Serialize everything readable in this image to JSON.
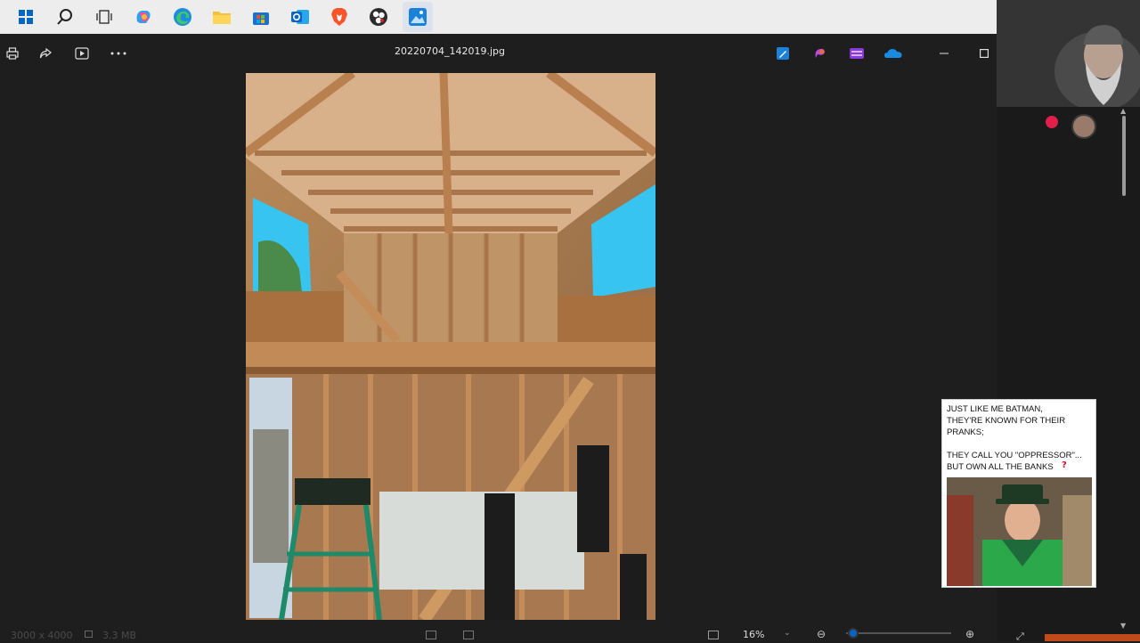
{
  "taskbar": {
    "icons": [
      "windows-start-icon",
      "search-icon",
      "task-view-icon",
      "copilot-icon",
      "edge-icon",
      "file-explorer-icon",
      "store-icon",
      "outlook-icon",
      "brave-icon",
      "obs-icon",
      "photos-icon"
    ]
  },
  "viewer": {
    "filename": "20220704_142019.jpg",
    "status": {
      "dimensions": "3000 x 4000",
      "filesize": "3.3 MB",
      "zoom": "16%"
    }
  },
  "meme": {
    "text": "JUST LIKE ME BATMAN,\nTHEY'RE KNOWN FOR THEIR\nPRANKS;\n\nTHEY CALL YOU \"OPPRESSOR\"...\nBUT OWN ALL THE BANKS",
    "question_mark": "?"
  },
  "colors": {
    "taskbar": "#ededed",
    "window": "#1e1e1e",
    "accent": "#0a64c8"
  }
}
